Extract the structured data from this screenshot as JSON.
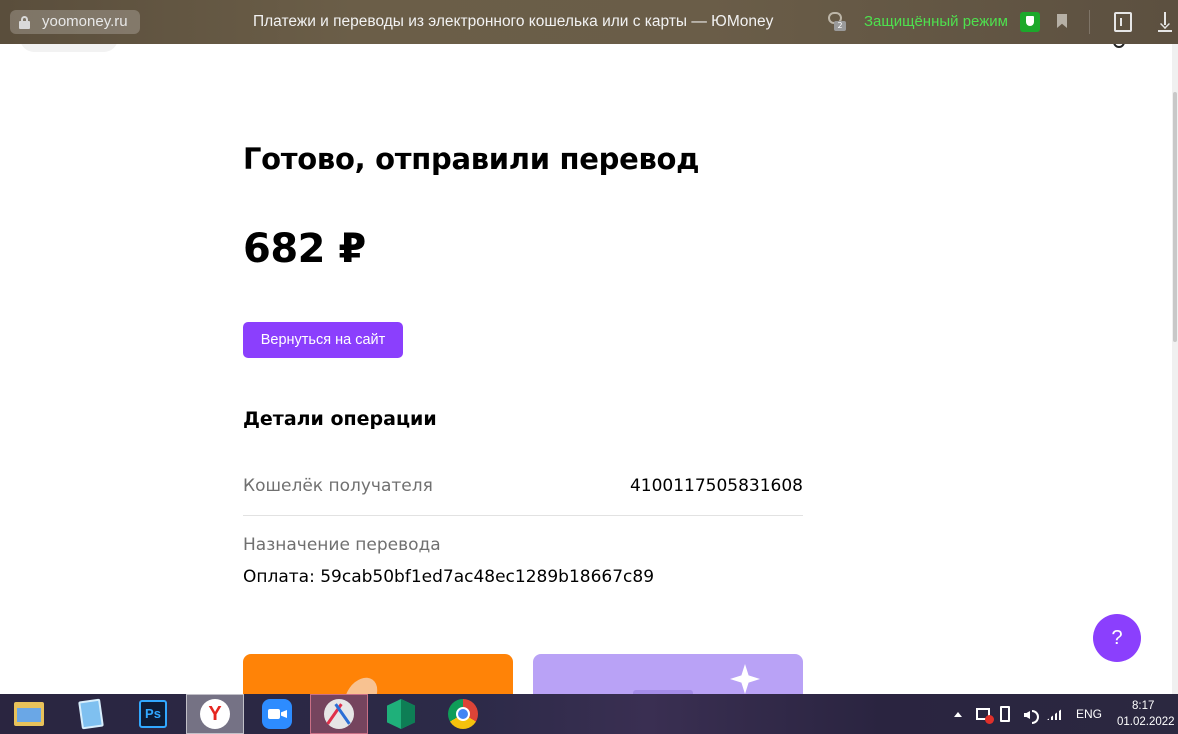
{
  "browser": {
    "url": "yoomoney.ru",
    "tab_title": "Платежи и переводы из электронного кошелька или с карты — ЮMoney",
    "extension_badge": "2",
    "protected_mode_label": "Защищённый режим"
  },
  "page": {
    "heading": "Готово, отправили перевод",
    "amount": "682 ₽",
    "back_button_label": "Вернуться на сайт",
    "details_heading": "Детали операции",
    "recipient_wallet_label": "Кошелёк получателя",
    "recipient_wallet_value": "4100117505831608",
    "purpose_label": "Назначение перевода",
    "purpose_value": "Оплата: 59cab50bf1ed7ac48ec1289b18667c89",
    "help_button_label": "?"
  },
  "taskbar": {
    "apps": [
      "file-explorer",
      "notepad",
      "photoshop",
      "yandex-browser",
      "zoom",
      "snipping-tool",
      "package-app",
      "chrome"
    ],
    "photoshop_label": "Ps",
    "yandex_label": "Y",
    "language": "ENG",
    "time": "8:17",
    "date": "01.02.2022"
  },
  "colors": {
    "accent": "#8b3ffd",
    "protected_mode": "#4ee04e",
    "card_orange": "#ff8307",
    "card_purple": "#b9a2f6"
  }
}
